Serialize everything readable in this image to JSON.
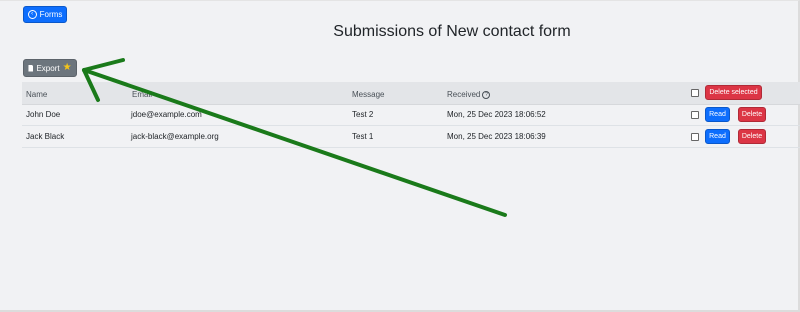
{
  "header": {
    "forms_button_label": "Forms",
    "title": "Submissions of New contact form"
  },
  "toolbar": {
    "export_label": "Export",
    "export_star_icon": "star-icon"
  },
  "table": {
    "columns": [
      "Name",
      "Email",
      "Message",
      "Received"
    ],
    "delete_selected_label": "Delete selected",
    "rows": [
      {
        "name": "John Doe",
        "email": "jdoe@example.com",
        "message": "Test 2",
        "received": "Mon, 25 Dec 2023 18:06:52",
        "read_label": "Read",
        "delete_label": "Delete"
      },
      {
        "name": "Jack Black",
        "email": "jack-black@example.org",
        "message": "Test 1",
        "received": "Mon, 25 Dec 2023 18:06:39",
        "read_label": "Read",
        "delete_label": "Delete"
      }
    ]
  },
  "colors": {
    "primary": "#0d6efd",
    "danger": "#dc3545",
    "secondary": "#6c757d",
    "annotation_arrow": "#1a7a1a"
  }
}
